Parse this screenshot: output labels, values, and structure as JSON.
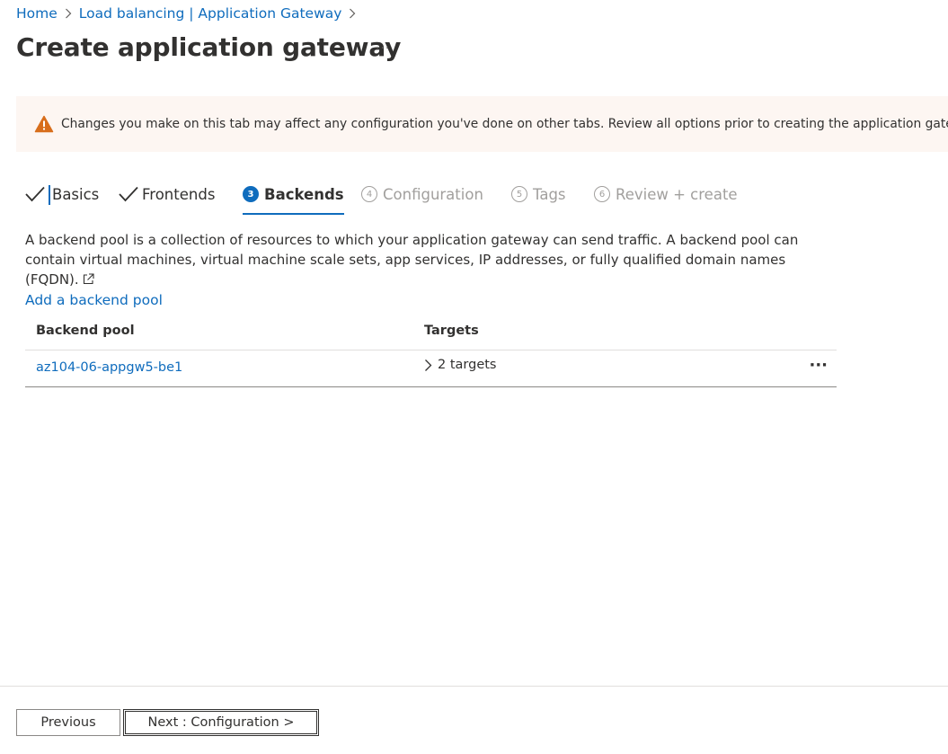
{
  "breadcrumb": {
    "items": [
      {
        "label": "Home"
      },
      {
        "label": "Load balancing | Application Gateway"
      }
    ]
  },
  "header": {
    "title": "Create application gateway",
    "more": "···"
  },
  "banner": {
    "message": "Changes you make on this tab may affect any configuration you've done on other tabs. Review all options prior to creating the application gateway.",
    "color": "#fdf6f2",
    "icon": "warning-icon"
  },
  "tabs": [
    {
      "label": "Basics",
      "state": "done"
    },
    {
      "label": "Frontends",
      "state": "done"
    },
    {
      "number": "3",
      "label": "Backends",
      "state": "active"
    },
    {
      "number": "4",
      "label": "Configuration",
      "state": "disabled"
    },
    {
      "number": "5",
      "label": "Tags",
      "state": "disabled"
    },
    {
      "number": "6",
      "label": "Review + create",
      "state": "disabled"
    }
  ],
  "description": "A backend pool is a collection of resources to which your application gateway can send traffic. A backend pool can contain virtual machines, virtual machine scale sets, app services, IP addresses, or fully qualified domain names (FQDN).",
  "add_link": "Add a backend pool",
  "table": {
    "columns": [
      "Backend pool",
      "Targets"
    ],
    "rows": [
      {
        "pool": "az104-06-appgw5-be1",
        "targets": "2 targets",
        "more": "···"
      }
    ]
  },
  "footer": {
    "previous_label": "Previous",
    "next_label": "Next : Configuration >"
  },
  "colors": {
    "accent": "#0f6cbd",
    "warning": "#d83b01",
    "disabled": "#a19f9d"
  }
}
